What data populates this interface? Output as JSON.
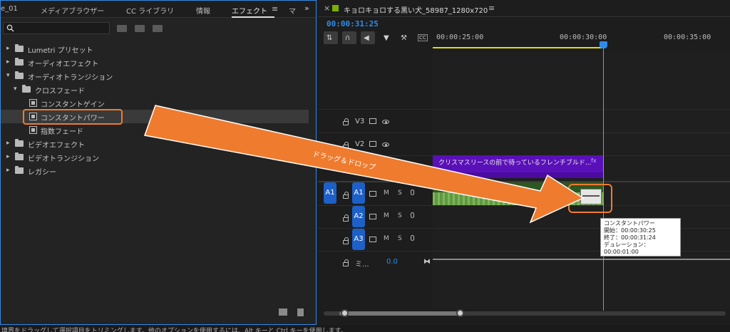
{
  "left_panel": {
    "tabs": [
      {
        "label": "e_01"
      },
      {
        "label": "メディアブラウザー"
      },
      {
        "label": "CC ライブラリ"
      },
      {
        "label": "情報"
      },
      {
        "label": "エフェクト"
      },
      {
        "label": "マ"
      }
    ],
    "active_tab": "エフェクト",
    "more_glyph": "»",
    "menu_glyph": "≡",
    "search": {
      "value": "",
      "placeholder": ""
    },
    "tree": [
      {
        "label": "Lumetri プリセット",
        "type": "folder",
        "expanded": false
      },
      {
        "label": "オーディオエフェクト",
        "type": "folder",
        "expanded": false
      },
      {
        "label": "オーディオトランジション",
        "type": "folder",
        "expanded": true
      },
      {
        "label": "クロスフェード",
        "type": "folder",
        "expanded": true
      },
      {
        "label": "コンスタントゲイン",
        "type": "effect"
      },
      {
        "label": "コンスタントパワー",
        "type": "effect",
        "selected": true
      },
      {
        "label": "指数フェード",
        "type": "effect"
      },
      {
        "label": "ビデオエフェクト",
        "type": "folder",
        "expanded": false
      },
      {
        "label": "ビデオトランジション",
        "type": "folder",
        "expanded": false
      },
      {
        "label": "レガシー",
        "type": "folder",
        "expanded": false
      }
    ]
  },
  "sequence": {
    "close_glyph": "×",
    "title": "キョロキョロする黒い犬_58987_1280x720",
    "menu_glyph": "≡",
    "timecode": "00:00:31:25",
    "ruler_labels": [
      "00:00:25:00",
      "00:00:30:00",
      "00:00:35:00"
    ],
    "tracks": {
      "v3": "V3",
      "v2": "V2",
      "a1_src": "A1",
      "a1": "A1",
      "a2": "A2",
      "a3": "A3",
      "m": "M",
      "s": "S"
    },
    "mix": {
      "label": "ミ...",
      "value": "0.0",
      "end_glyph": "⧓"
    },
    "video_clip": {
      "label": "クリスマスリースの前で待っているフレンチブルド...",
      "fx": "fx",
      "color": "#5a10b8"
    },
    "audio_clip": {
      "color": "#3c6e2c"
    },
    "tooltip": {
      "name": "コンスタントパワー",
      "start": "開始：00:00:30:25",
      "end": "終了：00:00:31:24",
      "duration": "デュレーション：00:00:01:00"
    }
  },
  "annotation": {
    "arrow_text": "ドラッグ＆ドロップ",
    "arrow_color": "#ef7b2e"
  },
  "status_bar": {
    "text": "境界をドラッグして選択項目をトリミングします。他のオプションを使用するには、Alt キーと Ctrl キーを使用します。"
  },
  "colors": {
    "accent_blue": "#2d8ceb",
    "highlight_orange": "#ef7b2e",
    "work_area_yellow": "#e3e000"
  }
}
